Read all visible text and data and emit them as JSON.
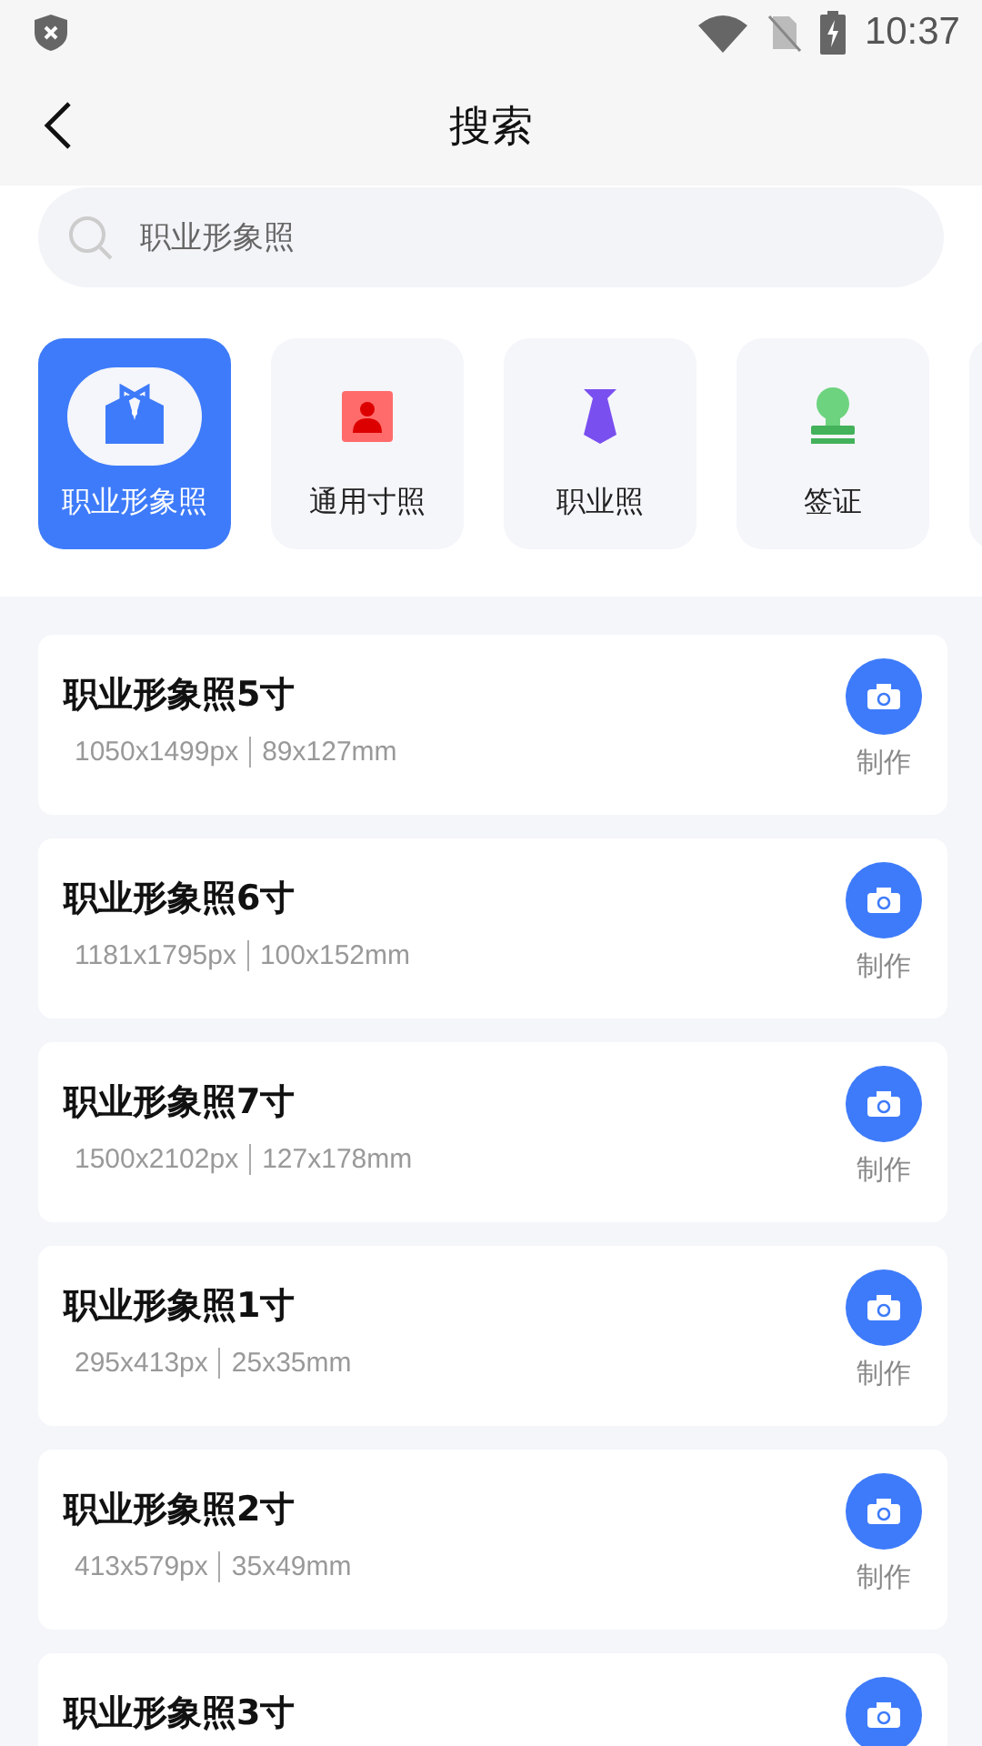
{
  "status_bar": {
    "time": "10:37"
  },
  "header": {
    "title": "搜索"
  },
  "search": {
    "placeholder": "职业形象照"
  },
  "categories": [
    {
      "kind": "suit",
      "label": "职业形象照",
      "selected": true
    },
    {
      "kind": "portrait",
      "label": "通用寸照",
      "selected": false
    },
    {
      "kind": "tie",
      "label": "职业照",
      "selected": false
    },
    {
      "kind": "stamp",
      "label": "签证",
      "selected": false
    }
  ],
  "results": [
    {
      "title": "职业形象照5寸",
      "size_px": "1050x1499px",
      "size_mm": "89x127mm",
      "action": "制作"
    },
    {
      "title": "职业形象照6寸",
      "size_px": "1181x1795px",
      "size_mm": "100x152mm",
      "action": "制作"
    },
    {
      "title": "职业形象照7寸",
      "size_px": "1500x2102px",
      "size_mm": "127x178mm",
      "action": "制作"
    },
    {
      "title": "职业形象照1寸",
      "size_px": "295x413px",
      "size_mm": "25x35mm",
      "action": "制作"
    },
    {
      "title": "职业形象照2寸",
      "size_px": "413x579px",
      "size_mm": "35x49mm",
      "action": "制作"
    },
    {
      "title": "职业形象照3寸"
    }
  ]
}
